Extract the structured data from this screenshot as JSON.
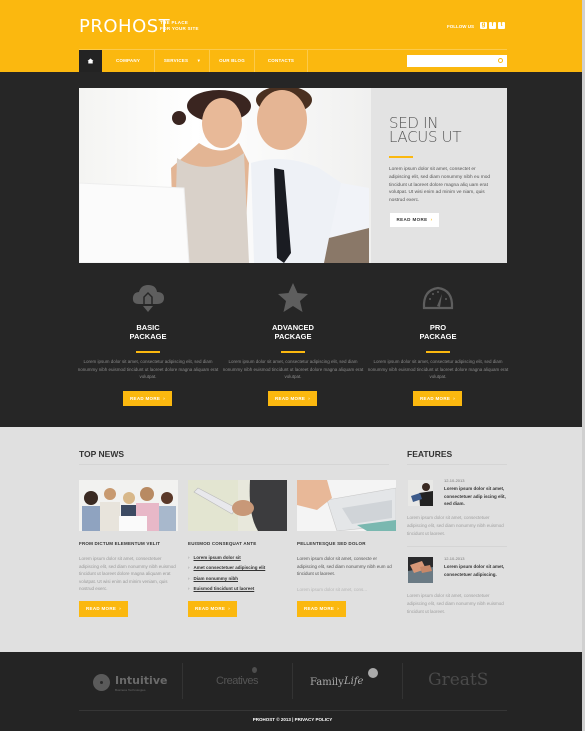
{
  "header": {
    "logo": "PROHOST",
    "tagline_line1": "THE PLACE",
    "tagline_line2": "FOR YOUR SITE",
    "follow_label": "FOLLOW US",
    "social": [
      {
        "name": "google-plus",
        "glyph": "g+"
      },
      {
        "name": "facebook",
        "glyph": "f"
      },
      {
        "name": "twitter",
        "glyph": "t"
      }
    ]
  },
  "nav": {
    "home_icon": "home-icon",
    "items": [
      {
        "label": "COMPANY"
      },
      {
        "label": "SERVICES",
        "has_dropdown": true
      },
      {
        "label": "OUR BLOG"
      },
      {
        "label": "CONTACTS"
      }
    ],
    "search": {
      "value": "",
      "placeholder": ""
    }
  },
  "hero": {
    "title_line1": "SED IN",
    "title_line2": "LACUS UT",
    "text": "Lorem ipsum dolor sit amet, consectet er adipiscing elit, sed diam nonummy nibh eu mod tincidunt ut laoreet dolore magna aliq uam erat volutpat. Ut wisi enim ad minim ve niam, quis nostrud exerc.",
    "button": "READ MORE",
    "arrow": "›"
  },
  "packages": [
    {
      "icon": "cloud-download-icon",
      "title_line1": "BASIC",
      "title_line2": "PACKAGE",
      "text": "Lorem ipsum dolor sit amet, consectetur adipiscing elit, sed diam nonummy nibh euismod tincidunt ut laoreet dolore magna aliquam erat volutpat.",
      "button": "READ MORE"
    },
    {
      "icon": "star-icon",
      "title_line1": "ADVANCED",
      "title_line2": "PACKAGE",
      "text": "Lorem ipsum dolor sit amet, consectetur adipiscing elit, sed diam nonummy nibh euismod tincidunt ut laoreet dolore magna aliquam erat volutpat.",
      "button": "READ MORE"
    },
    {
      "icon": "speedometer-icon",
      "title_line1": "PRO",
      "title_line2": "PACKAGE",
      "text": "Lorem ipsum dolor sit amet, consectetur adipiscing elit, sed diam nonummy nibh euismod tincidunt ut laoreet dolore magna aliquam erat volutpat.",
      "button": "READ MORE"
    }
  ],
  "top_news": {
    "title": "TOP NEWS",
    "items": [
      {
        "title": "FROM DICTUM ELEMENTUM VELIT",
        "text": "Lorem ipsum dolor sit amet, consectetuer adipiscing elit, sed diam nonummy nibh euismod tincidunt ut laoreet dolore magna aliquam erat volutpat. Ut wisi enim ad minim veniam, quis nostrud exerc.",
        "button": "READ MORE"
      },
      {
        "title": "EUISMOD CONSEQUAT ANTE",
        "links": [
          "Lorem ipsum dolor sit",
          "Amet consectetuer adipiscing elit",
          "Diam nonummy nibh",
          "Euismod tincidunt ut laoreet"
        ],
        "button": "READ MORE"
      },
      {
        "title": "PELLENTESQUE SED DOLOR",
        "text": "Lorem ipsum dolor sit amet, consecte er adipiscing elit, sed diam nonummy nibh eum od tincidunt ut laoreet.",
        "text2": "Lorem ipsum dolor sit amet, cons...",
        "button": "READ MORE"
      }
    ]
  },
  "features": {
    "title": "FEATURES",
    "items": [
      {
        "date": "12-10-2013",
        "headline": "Lorem ipsum dolor sit amet, consectetuer adip iscing elit, sed diam.",
        "text": "Lorem ipsum dolor sit amet, consectetuer adipiscing elit, sed diam nonummy nibh euismod tincidunt ut laoreet."
      },
      {
        "date": "12-10-2013",
        "headline": "Lorem ipsum dolor sit amet, consectetuer adipiscing.",
        "text": "Lorem ipsum dolor sit amet, consectetuer adipiscing elit, sed diam nonummy nibh euismod tincidunt ut laoreet."
      }
    ]
  },
  "footer": {
    "partners": [
      {
        "name": "Intuitive",
        "sub": "Business Technologies"
      },
      {
        "name": "Creatives"
      },
      {
        "name": "Family",
        "script": "Life"
      },
      {
        "name": "GreatS"
      }
    ],
    "copyright": "PROHOST © 2013 | PRIVACY POLICY"
  },
  "colors": {
    "accent": "#fbb80f",
    "dark": "#262626",
    "light": "#e0e0e0"
  }
}
